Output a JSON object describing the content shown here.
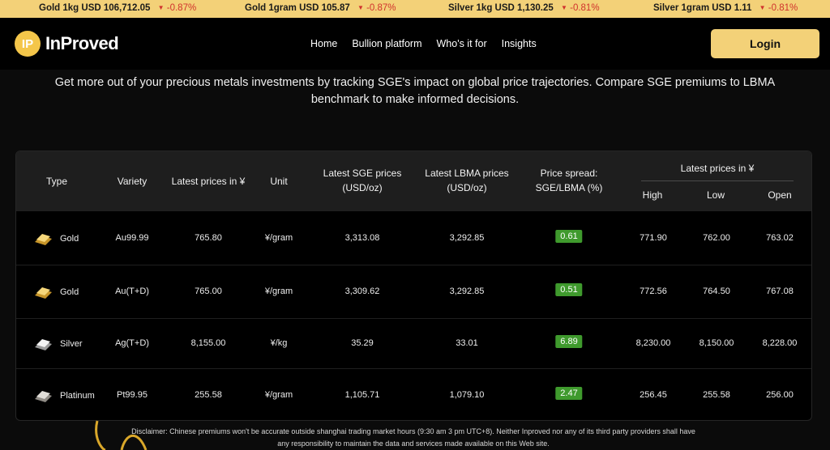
{
  "ticker": [
    {
      "name": "Gold 1kg USD 106,712.05",
      "change": "-0.87%"
    },
    {
      "name": "Gold 1gram USD 105.87",
      "change": "-0.87%"
    },
    {
      "name": "Silver 1kg USD 1,130.25",
      "change": "-0.81%"
    },
    {
      "name": "Silver 1gram USD 1.11",
      "change": "-0.81%"
    }
  ],
  "brand": {
    "mark": "IP",
    "name": "InProved"
  },
  "nav": [
    "Home",
    "Bullion platform",
    "Who's it for",
    "Insights"
  ],
  "login_label": "Login",
  "intro": "Get more out of your precious metals investments by tracking SGE's impact on global price trajectories. Compare SGE premiums to LBMA benchmark to make informed decisions.",
  "table": {
    "headers": {
      "type": "Type",
      "variety": "Variety",
      "latest_cny": "Latest prices in ¥",
      "unit": "Unit",
      "sge": "Latest SGE prices (USD/oz)",
      "lbma": "Latest LBMA prices (USD/oz)",
      "spread": "Price spread: SGE/LBMA (%)",
      "group": "Latest prices in ¥",
      "high": "High",
      "low": "Low",
      "open": "Open"
    },
    "rows": [
      {
        "type": "Gold",
        "metal": "gold",
        "variety": "Au99.99",
        "latest": "765.80",
        "unit": "¥/gram",
        "sge": "3,313.08",
        "lbma": "3,292.85",
        "spread": "0.61",
        "high": "771.90",
        "low": "762.00",
        "open": "763.02"
      },
      {
        "type": "Gold",
        "metal": "gold",
        "variety": "Au(T+D)",
        "latest": "765.00",
        "unit": "¥/gram",
        "sge": "3,309.62",
        "lbma": "3,292.85",
        "spread": "0.51",
        "high": "772.56",
        "low": "764.50",
        "open": "767.08"
      },
      {
        "type": "Silver",
        "metal": "silver",
        "variety": "Ag(T+D)",
        "latest": "8,155.00",
        "unit": "¥/kg",
        "sge": "35.29",
        "lbma": "33.01",
        "spread": "6.89",
        "high": "8,230.00",
        "low": "8,150.00",
        "open": "8,228.00"
      },
      {
        "type": "Platinum",
        "metal": "platinum",
        "variety": "Pt99.95",
        "latest": "255.58",
        "unit": "¥/gram",
        "sge": "1,105.71",
        "lbma": "1,079.10",
        "spread": "2.47",
        "high": "256.45",
        "low": "255.58",
        "open": "256.00"
      }
    ]
  },
  "disclaimer": "Disclaimer: Chinese premiums won't be accurate outside shanghai trading market hours (9:30 am 3 pm UTC+8). Neither Inproved nor any of its third party providers shall have any responsibility to maintain the data and services made available on this Web site.",
  "colors": {
    "accent": "#f3d178",
    "negative": "#d0322d",
    "positive": "#3f9a2d"
  }
}
